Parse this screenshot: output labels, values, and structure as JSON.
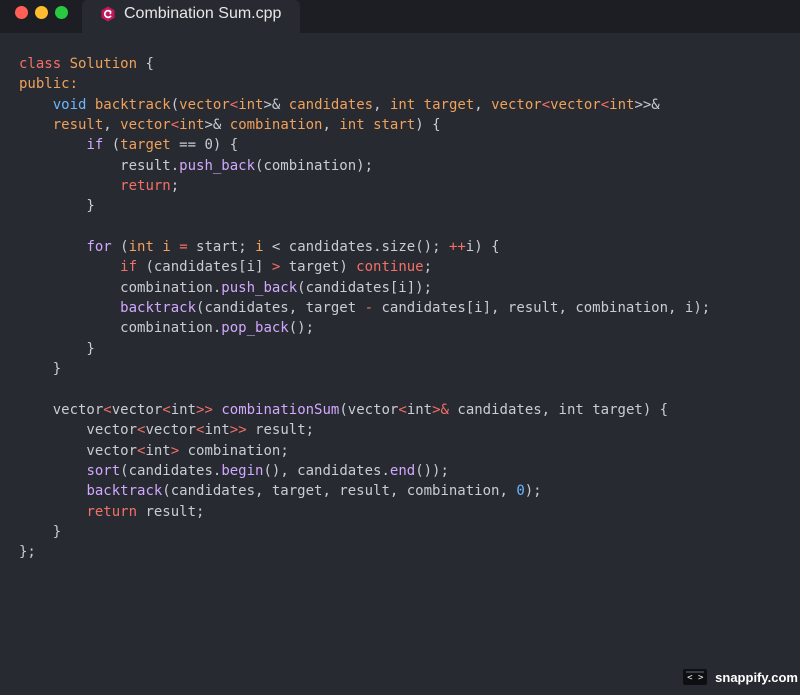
{
  "window": {
    "controls": {
      "close_color": "#ff5f57",
      "minimize_color": "#febc2e",
      "maximize_color": "#28c840"
    },
    "tab": {
      "title": "Combination Sum.cpp",
      "icon": "cpp-file-icon",
      "icon_color": "#c2185b"
    }
  },
  "colors": {
    "keyword": "#f47067",
    "type": "#c9ccd3",
    "identifier": "#f0a15b",
    "function": "#d2a8ff",
    "plain": "#c9ccd3",
    "number": "#6cb6ff",
    "void": "#6cb6ff"
  },
  "code": {
    "lines": [
      [
        {
          "t": "class ",
          "c": "keyword"
        },
        {
          "t": "Solution",
          "c": "identifier"
        },
        {
          "t": " {",
          "c": "plain"
        }
      ],
      [
        {
          "t": "public:",
          "c": "identifier"
        }
      ],
      [
        {
          "t": "    ",
          "c": "plain"
        },
        {
          "t": "void",
          "c": "void"
        },
        {
          "t": " ",
          "c": "plain"
        },
        {
          "t": "backtrack",
          "c": "identifier"
        },
        {
          "t": "(",
          "c": "plain"
        },
        {
          "t": "vector",
          "c": "identifier"
        },
        {
          "t": "<",
          "c": "keyword"
        },
        {
          "t": "int",
          "c": "identifier"
        },
        {
          "t": ">& ",
          "c": "plain"
        },
        {
          "t": "candidates",
          "c": "identifier"
        },
        {
          "t": ", ",
          "c": "plain"
        },
        {
          "t": "int",
          "c": "identifier"
        },
        {
          "t": " target",
          "c": "identifier"
        },
        {
          "t": ", ",
          "c": "plain"
        },
        {
          "t": "vector",
          "c": "identifier"
        },
        {
          "t": "<",
          "c": "keyword"
        },
        {
          "t": "vector",
          "c": "identifier"
        },
        {
          "t": "<",
          "c": "keyword"
        },
        {
          "t": "int",
          "c": "identifier"
        },
        {
          "t": ">>&",
          "c": "plain"
        }
      ],
      [
        {
          "t": "    ",
          "c": "plain"
        },
        {
          "t": "result",
          "c": "identifier"
        },
        {
          "t": ", ",
          "c": "plain"
        },
        {
          "t": "vector",
          "c": "identifier"
        },
        {
          "t": "<",
          "c": "keyword"
        },
        {
          "t": "int",
          "c": "identifier"
        },
        {
          "t": ">& ",
          "c": "plain"
        },
        {
          "t": "combination",
          "c": "identifier"
        },
        {
          "t": ", ",
          "c": "plain"
        },
        {
          "t": "int",
          "c": "identifier"
        },
        {
          "t": " start",
          "c": "identifier"
        },
        {
          "t": ") {",
          "c": "plain"
        }
      ],
      [
        {
          "t": "        ",
          "c": "plain"
        },
        {
          "t": "if",
          "c": "function"
        },
        {
          "t": " (",
          "c": "plain"
        },
        {
          "t": "target",
          "c": "identifier"
        },
        {
          "t": " == ",
          "c": "plain"
        },
        {
          "t": "0",
          "c": "plain"
        },
        {
          "t": ") {",
          "c": "plain"
        }
      ],
      [
        {
          "t": "            result.",
          "c": "plain"
        },
        {
          "t": "push_back",
          "c": "function"
        },
        {
          "t": "(combination);",
          "c": "plain"
        }
      ],
      [
        {
          "t": "            ",
          "c": "plain"
        },
        {
          "t": "return",
          "c": "keyword"
        },
        {
          "t": ";",
          "c": "plain"
        }
      ],
      [
        {
          "t": "        }",
          "c": "plain"
        }
      ],
      [
        {
          "t": "",
          "c": "plain"
        }
      ],
      [
        {
          "t": "        ",
          "c": "plain"
        },
        {
          "t": "for",
          "c": "function"
        },
        {
          "t": " (",
          "c": "plain"
        },
        {
          "t": "int",
          "c": "identifier"
        },
        {
          "t": " i ",
          "c": "identifier"
        },
        {
          "t": "=",
          "c": "keyword"
        },
        {
          "t": " start; ",
          "c": "plain"
        },
        {
          "t": "i",
          "c": "identifier"
        },
        {
          "t": " < candidates.size(); ",
          "c": "plain"
        },
        {
          "t": "++",
          "c": "keyword"
        },
        {
          "t": "i) {",
          "c": "plain"
        }
      ],
      [
        {
          "t": "            ",
          "c": "plain"
        },
        {
          "t": "if",
          "c": "keyword"
        },
        {
          "t": " (candidates[i] ",
          "c": "plain"
        },
        {
          "t": ">",
          "c": "keyword"
        },
        {
          "t": " target) ",
          "c": "plain"
        },
        {
          "t": "continue",
          "c": "keyword"
        },
        {
          "t": ";",
          "c": "plain"
        }
      ],
      [
        {
          "t": "            combination.",
          "c": "plain"
        },
        {
          "t": "push_back",
          "c": "function"
        },
        {
          "t": "(candidates[i]);",
          "c": "plain"
        }
      ],
      [
        {
          "t": "            ",
          "c": "plain"
        },
        {
          "t": "backtrack",
          "c": "function"
        },
        {
          "t": "(candidates, target ",
          "c": "plain"
        },
        {
          "t": "-",
          "c": "keyword"
        },
        {
          "t": " candidates[i], result, combination, i);",
          "c": "plain"
        }
      ],
      [
        {
          "t": "            combination.",
          "c": "plain"
        },
        {
          "t": "pop_back",
          "c": "function"
        },
        {
          "t": "();",
          "c": "plain"
        }
      ],
      [
        {
          "t": "        }",
          "c": "plain"
        }
      ],
      [
        {
          "t": "    }",
          "c": "plain"
        }
      ],
      [
        {
          "t": "",
          "c": "plain"
        }
      ],
      [
        {
          "t": "    vector",
          "c": "plain"
        },
        {
          "t": "<",
          "c": "keyword"
        },
        {
          "t": "vector",
          "c": "plain"
        },
        {
          "t": "<",
          "c": "keyword"
        },
        {
          "t": "int",
          "c": "plain"
        },
        {
          "t": ">>",
          "c": "keyword"
        },
        {
          "t": " ",
          "c": "plain"
        },
        {
          "t": "combinationSum",
          "c": "function"
        },
        {
          "t": "(vector",
          "c": "plain"
        },
        {
          "t": "<",
          "c": "keyword"
        },
        {
          "t": "int",
          "c": "plain"
        },
        {
          "t": ">&",
          "c": "keyword"
        },
        {
          "t": " candidates, int target) {",
          "c": "plain"
        }
      ],
      [
        {
          "t": "        vector",
          "c": "plain"
        },
        {
          "t": "<",
          "c": "keyword"
        },
        {
          "t": "vector",
          "c": "plain"
        },
        {
          "t": "<",
          "c": "keyword"
        },
        {
          "t": "int",
          "c": "plain"
        },
        {
          "t": ">>",
          "c": "keyword"
        },
        {
          "t": " result;",
          "c": "plain"
        }
      ],
      [
        {
          "t": "        vector",
          "c": "plain"
        },
        {
          "t": "<",
          "c": "keyword"
        },
        {
          "t": "int",
          "c": "plain"
        },
        {
          "t": ">",
          "c": "keyword"
        },
        {
          "t": " combination;",
          "c": "plain"
        }
      ],
      [
        {
          "t": "        ",
          "c": "plain"
        },
        {
          "t": "sort",
          "c": "function"
        },
        {
          "t": "(candidates.",
          "c": "plain"
        },
        {
          "t": "begin",
          "c": "function"
        },
        {
          "t": "(), candidates.",
          "c": "plain"
        },
        {
          "t": "end",
          "c": "function"
        },
        {
          "t": "());",
          "c": "plain"
        }
      ],
      [
        {
          "t": "        ",
          "c": "plain"
        },
        {
          "t": "backtrack",
          "c": "function"
        },
        {
          "t": "(candidates, target, result, combination, ",
          "c": "plain"
        },
        {
          "t": "0",
          "c": "number"
        },
        {
          "t": ");",
          "c": "plain"
        }
      ],
      [
        {
          "t": "        ",
          "c": "plain"
        },
        {
          "t": "return",
          "c": "keyword"
        },
        {
          "t": " result;",
          "c": "plain"
        }
      ],
      [
        {
          "t": "    }",
          "c": "plain"
        }
      ],
      [
        {
          "t": "};",
          "c": "plain"
        }
      ]
    ]
  },
  "watermark": {
    "glyph": "< >",
    "text": "snappify.com"
  }
}
